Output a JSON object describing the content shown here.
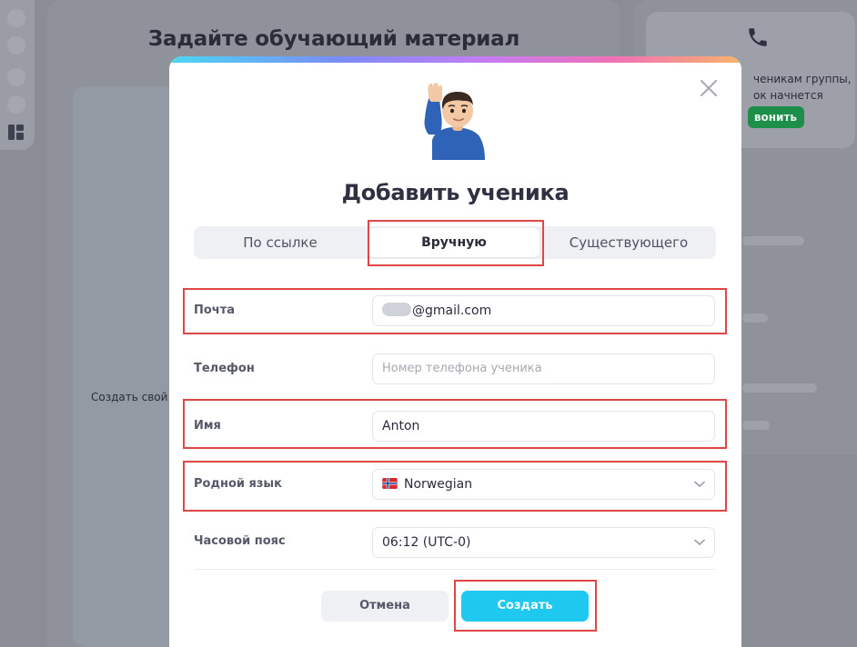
{
  "background": {
    "page_title": "Задайте обучающий материал",
    "create_own_text": "Создать свой",
    "call_card": {
      "text_line1": "ченикам группы,",
      "text_line2": "ок начнется",
      "button_label": "вонить"
    }
  },
  "modal": {
    "title": "Добавить ученика",
    "emoji": "man-raising-hand",
    "tabs": [
      {
        "label": "По ссылке",
        "active": false
      },
      {
        "label": "Вручную",
        "active": true
      },
      {
        "label": "Существующего",
        "active": false
      }
    ],
    "fields": {
      "email": {
        "label": "Почта",
        "value": "@gmail.com"
      },
      "phone": {
        "label": "Телефон",
        "placeholder": "Номер телефона ученика"
      },
      "name": {
        "label": "Имя",
        "value": "Anton"
      },
      "native_language": {
        "label": "Родной язык",
        "value": "Norwegian",
        "flag": "norway-flag"
      },
      "timezone": {
        "label": "Часовой пояс",
        "value": "06:12 (UTC-0)"
      }
    },
    "buttons": {
      "cancel": "Отмена",
      "create": "Создать"
    }
  },
  "colors": {
    "accent": "#1ec8ee",
    "highlight": "#e04646",
    "call_button": "#1e8f4a"
  }
}
